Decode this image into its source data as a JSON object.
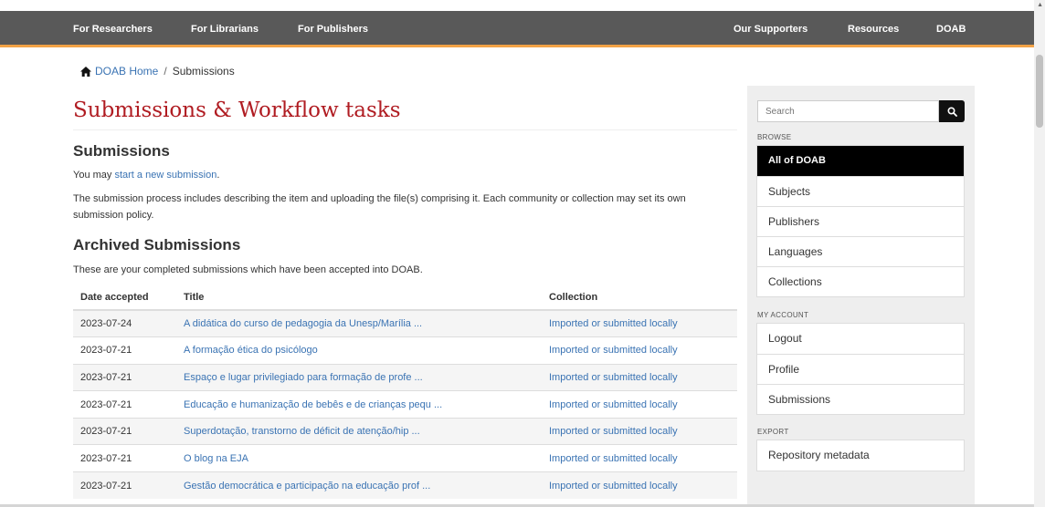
{
  "navbar": {
    "left_items": [
      "For Researchers",
      "For Librarians",
      "For Publishers"
    ],
    "right_items": [
      "Our Supporters",
      "Resources",
      "DOAB"
    ]
  },
  "breadcrumb": {
    "home": "DOAB Home",
    "separator": "/",
    "current": "Submissions"
  },
  "page_title": "Submissions & Workflow tasks",
  "submissions": {
    "heading": "Submissions",
    "intro_prefix": "You may ",
    "intro_link": "start a new submission",
    "intro_suffix": ".",
    "description": "The submission process includes describing the item and uploading the file(s) comprising it. Each community or collection may set its own submission policy."
  },
  "archived": {
    "heading": "Archived Submissions",
    "description": "These are your completed submissions which have been accepted into DOAB.",
    "columns": [
      "Date accepted",
      "Title",
      "Collection"
    ],
    "rows": [
      {
        "date": "2023-07-24",
        "title": "A didática do curso de pedagogia da Unesp/Marília ...",
        "collection": "Imported or submitted locally"
      },
      {
        "date": "2023-07-21",
        "title": "A formação ética do psicólogo",
        "collection": "Imported or submitted locally"
      },
      {
        "date": "2023-07-21",
        "title": "Espaço e lugar privilegiado para formação de profe ...",
        "collection": "Imported or submitted locally"
      },
      {
        "date": "2023-07-21",
        "title": "Educação e humanização de bebês e de crianças pequ ...",
        "collection": "Imported or submitted locally"
      },
      {
        "date": "2023-07-21",
        "title": "Superdotação, transtorno de déficit de atenção/hip ...",
        "collection": "Imported or submitted locally"
      },
      {
        "date": "2023-07-21",
        "title": "O blog na EJA",
        "collection": "Imported or submitted locally"
      },
      {
        "date": "2023-07-21",
        "title": "Gestão democrática e participação na educação prof ...",
        "collection": "Imported or submitted locally"
      }
    ]
  },
  "sidebar": {
    "search_placeholder": "Search",
    "browse_label": "BROWSE",
    "browse_items": [
      "All of DOAB",
      "Subjects",
      "Publishers",
      "Languages",
      "Collections"
    ],
    "account_label": "MY ACCOUNT",
    "account_items": [
      "Logout",
      "Profile",
      "Submissions"
    ],
    "export_label": "EXPORT",
    "export_items": [
      "Repository metadata"
    ]
  },
  "colors": {
    "navbar": "#595959",
    "navbar_accent": "#f2a246",
    "title": "#b01c22",
    "link": "#3a73b3",
    "active_item": "#000000"
  },
  "icons": [
    "home-icon",
    "search-icon"
  ]
}
